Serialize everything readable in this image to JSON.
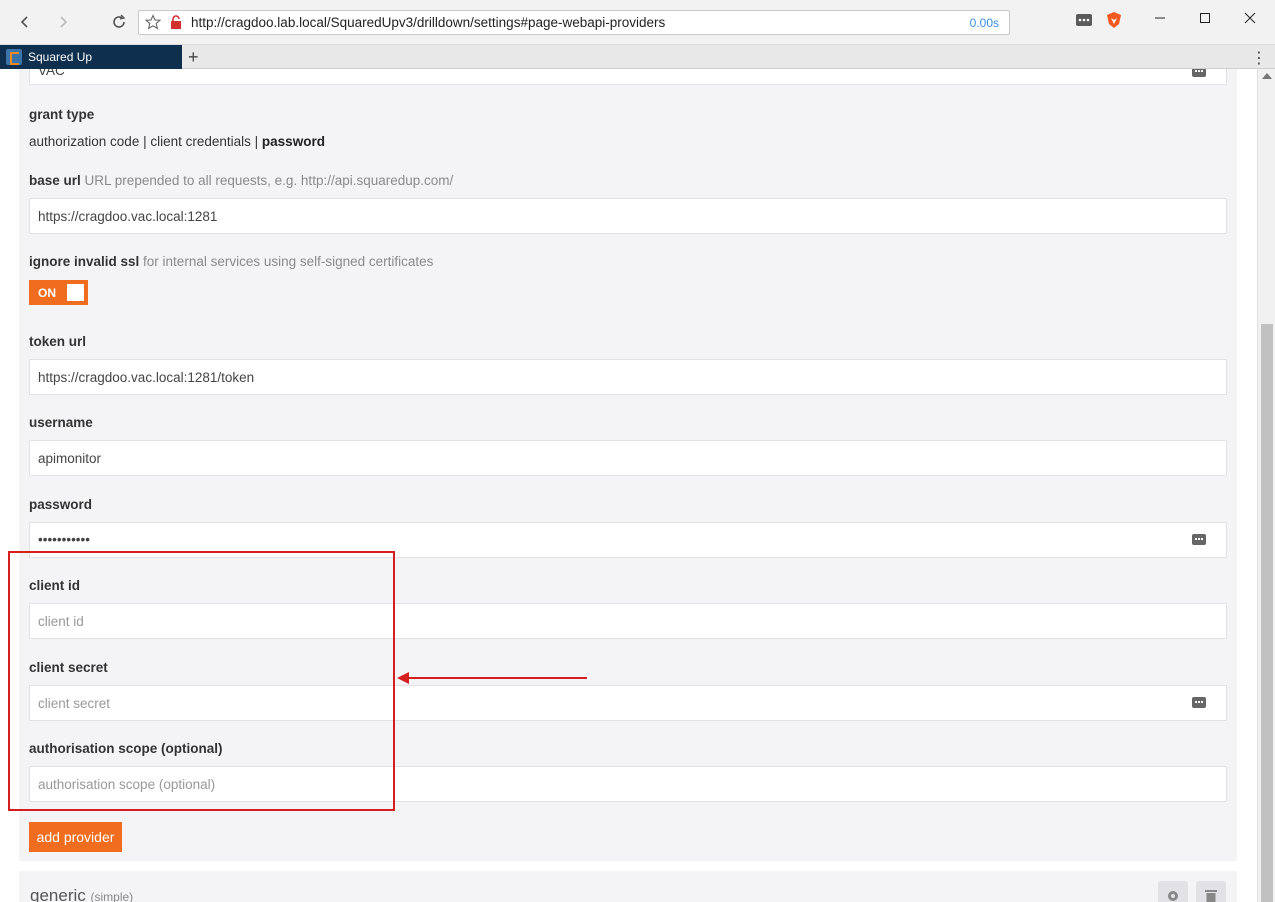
{
  "browser": {
    "url": "http://cragdoo.lab.local/SquaredUpv3/drilldown/settings#page-webapi-providers",
    "load_time": "0.00s",
    "tab_title": "Squared Up",
    "new_tab": "+",
    "menu": "⋮"
  },
  "form": {
    "top_value": "VAC",
    "grant_type_label": "grant type",
    "grant_options": [
      "authorization code",
      "client credentials",
      "password"
    ],
    "grant_separator": " | ",
    "grant_selected": "password",
    "base_url_label": "base url",
    "base_url_hint": "URL prepended to all requests, e.g. http://api.squaredup.com/",
    "base_url_value": "https://cragdoo.vac.local:1281",
    "ignore_ssl_label": "ignore invalid ssl",
    "ignore_ssl_hint": "for internal services using self-signed certificates",
    "ignore_ssl_toggle": "ON",
    "token_url_label": "token url",
    "token_url_value": "https://cragdoo.vac.local:1281/token",
    "username_label": "username",
    "username_value": "apimonitor",
    "password_label": "password",
    "password_value": "•••••••••••",
    "client_id_label": "client id",
    "client_id_placeholder": "client id",
    "client_secret_label": "client secret",
    "client_secret_placeholder": "client secret",
    "scope_label": "authorisation scope (optional)",
    "scope_placeholder": "authorisation scope (optional)",
    "add_button": "add provider"
  },
  "provider": {
    "name": "generic",
    "type": "(simple)"
  },
  "colors": {
    "accent": "#f06c1e",
    "annotation": "#d41f1f"
  }
}
